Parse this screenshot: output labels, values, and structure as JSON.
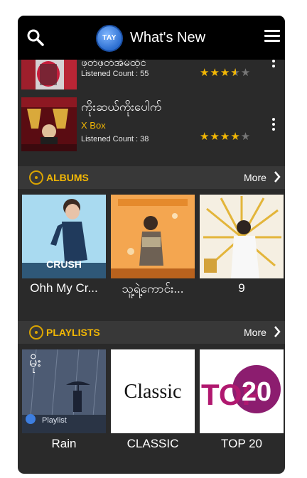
{
  "header": {
    "title": "What's New",
    "logo_text": "TAY"
  },
  "songs": [
    {
      "title": "ဖုတ်ဖုတ်အိမ်ထိုင်",
      "count_text": "Listened Count : 55",
      "rating": 3.5
    },
    {
      "title": "ကိုးဆယ်ကိုးပေါက်",
      "artist": "X Box",
      "count_text": "Listened Count : 38",
      "rating": 4
    }
  ],
  "albums_section": {
    "title": "ALBUMS",
    "more": "More"
  },
  "albums": [
    {
      "title": "Ohh My Cr...",
      "cover_text": "CRUSH"
    },
    {
      "title": "သူ့ရဲ့ကောင်း..."
    },
    {
      "title": "9"
    }
  ],
  "playlists_section": {
    "title": "PLAYLISTS",
    "more": "More"
  },
  "playlists": [
    {
      "title": "Rain",
      "cover_text": "မိုး",
      "cover_sub": "Playlist"
    },
    {
      "title": "CLASSIC",
      "cover_text": "Classic"
    },
    {
      "title": "TOP 20",
      "cover_text_a": "TOP",
      "cover_text_b": "20"
    }
  ],
  "colors": {
    "accent": "#f2b705",
    "bar": "#000000",
    "panel": "#2a2a2a",
    "section": "#383838"
  },
  "icons": [
    "search-icon",
    "app-logo",
    "menu-icon",
    "star-icon",
    "kebab-icon",
    "disc-icon",
    "chevron-right-icon"
  ]
}
